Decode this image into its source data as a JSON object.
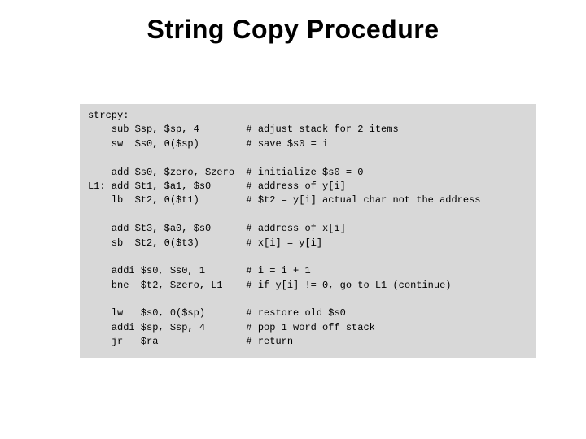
{
  "title": "String Copy Procedure",
  "code": {
    "lines": [
      "strcpy:",
      "    sub $sp, $sp, 4        # adjust stack for 2 items",
      "    sw  $s0, 0($sp)        # save $s0 = i",
      "",
      "    add $s0, $zero, $zero  # initialize $s0 = 0",
      "L1: add $t1, $a1, $s0      # address of y[i]",
      "    lb  $t2, 0($t1)        # $t2 = y[i] actual char not the address",
      "",
      "    add $t3, $a0, $s0      # address of x[i]",
      "    sb  $t2, 0($t3)        # x[i] = y[i]",
      "",
      "    addi $s0, $s0, 1       # i = i + 1",
      "    bne  $t2, $zero, L1    # if y[i] != 0, go to L1 (continue)",
      "",
      "    lw   $s0, 0($sp)       # restore old $s0",
      "    addi $sp, $sp, 4       # pop 1 word off stack",
      "    jr   $ra               # return"
    ]
  }
}
